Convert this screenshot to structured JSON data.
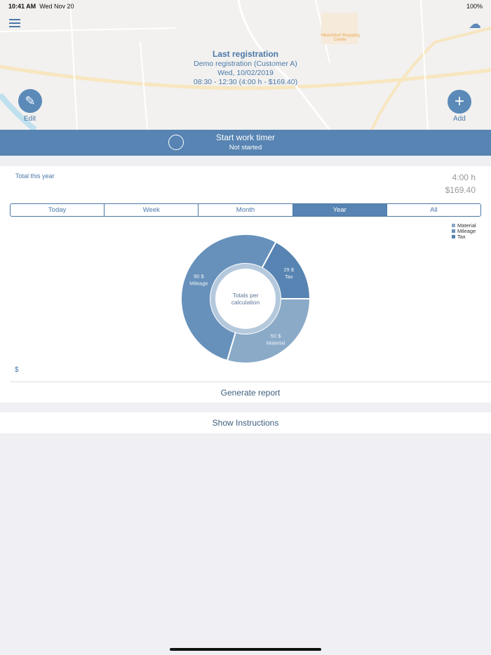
{
  "status": {
    "time": "10:41 AM",
    "date": "Wed Nov 20",
    "battery": "100%"
  },
  "map": {
    "poi": "Hilvertshof Shopping Center"
  },
  "last": {
    "title": "Last registration",
    "name": "Demo registration (Customer A)",
    "date": "Wed, 10/02/2019",
    "time": "08:30 - 12:30 (4:00 h - $169.40)"
  },
  "edit_label": "Edit",
  "add_label": "Add",
  "timer": {
    "title": "Start work timer",
    "status": "Not started"
  },
  "summary": {
    "label": "Total this year",
    "hours": "4:00 h",
    "amount": "$169.40"
  },
  "tabs": [
    "Today",
    "Week",
    "Month",
    "Year",
    "All"
  ],
  "active_tab": "Year",
  "currency": "$",
  "generate": "Generate report",
  "instructions": "Show Instructions",
  "chart_data": {
    "type": "pie",
    "center_label": "Totals per calculation",
    "slices": [
      {
        "name": "Material",
        "value": 50,
        "label": "50 $",
        "color": "#8aaac8"
      },
      {
        "name": "Mileage",
        "value": 90,
        "label": "90 $",
        "color": "#6791bb"
      },
      {
        "name": "Tax",
        "value": 29,
        "label": "29 $",
        "color": "#5784b2"
      }
    ],
    "legend": "top-right"
  }
}
